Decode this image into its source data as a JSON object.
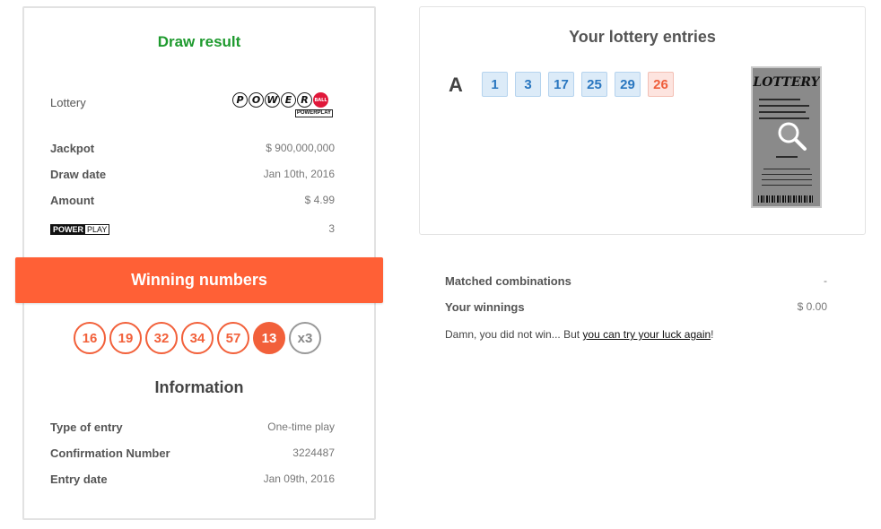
{
  "draw": {
    "title": "Draw result",
    "lottery_label": "Lottery",
    "lottery_logo": {
      "letters": [
        "P",
        "O",
        "W",
        "E",
        "R"
      ],
      "ball_text": "BALL",
      "sub_text": "POWERPLAY",
      "accent": "#e0183a"
    },
    "jackpot_label": "Jackpot",
    "jackpot_value": "$ 900,000,000",
    "draw_date_label": "Draw date",
    "draw_date_value": "Jan 10th, 2016",
    "amount_label": "Amount",
    "amount_value": "$ 4.99",
    "powerplay_logo_a": "POWER",
    "powerplay_logo_b": "PLAY",
    "powerplay_value": "3"
  },
  "winning": {
    "title": "Winning numbers",
    "banner_color": "#ff6036",
    "balls": [
      "16",
      "19",
      "32",
      "34",
      "57"
    ],
    "powerball": "13",
    "multiplier": "x3"
  },
  "information": {
    "title": "Information",
    "type_label": "Type of entry",
    "type_value": "One-time play",
    "confirmation_label": "Confirmation Number",
    "confirmation_value": "3224487",
    "entry_date_label": "Entry date",
    "entry_date_value": "Jan 09th, 2016"
  },
  "entries": {
    "title": "Your lottery entries",
    "line_letter": "A",
    "numbers": [
      "1",
      "3",
      "17",
      "25",
      "29"
    ],
    "powerball": "26",
    "ticket_logo": "LOTTERY",
    "ticket_icon": "magnifier-icon"
  },
  "results": {
    "matched_label": "Matched combinations",
    "matched_value": "-",
    "winnings_label": "Your winnings",
    "winnings_value": "$ 0.00",
    "message_prefix": "Damn, you did not win... But ",
    "message_link": "you can try your luck again",
    "message_suffix": "!"
  }
}
